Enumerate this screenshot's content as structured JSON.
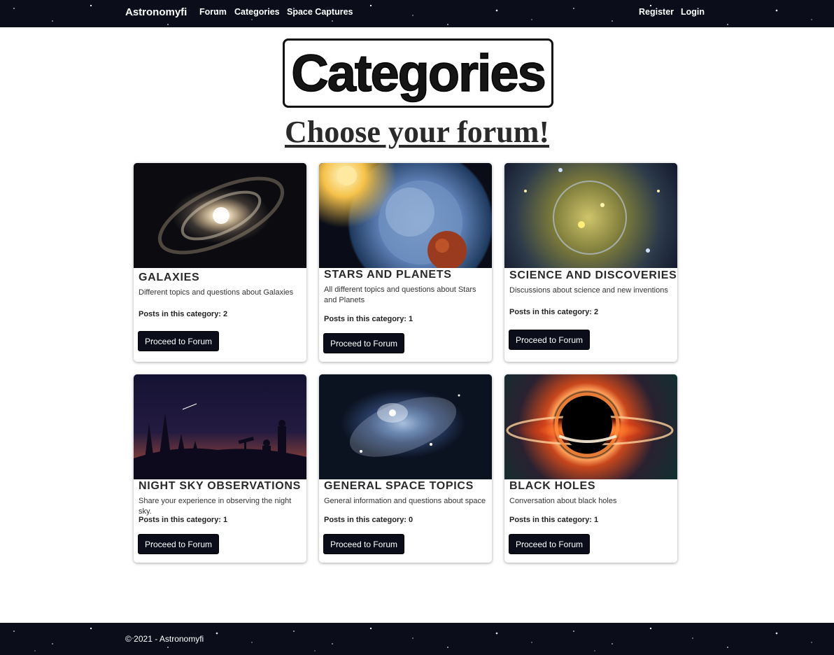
{
  "nav": {
    "brand": "Astronomyfi",
    "links": [
      "Forum",
      "Categories",
      "Space Captures"
    ],
    "register": "Register",
    "login": "Login"
  },
  "header": {
    "logo_text": "Categories",
    "subtitle": "Choose your forum!"
  },
  "cards": [
    {
      "title": "GALAXIES",
      "description": "Different topics and questions about Galaxies",
      "posts_label": "Posts in this category: 2",
      "button": "Proceed to Forum",
      "image_icon": "galaxy-image"
    },
    {
      "title": "STARS AND PLANETS",
      "description": "All different topics and questions about Stars and Planets",
      "posts_label": "Posts in this category: 1",
      "button": "Proceed to Forum",
      "image_icon": "planets-image"
    },
    {
      "title": "SCIENCE AND DISCOVERIES",
      "description": "Discussions about science and new inventions",
      "posts_label": "Posts in this category: 2",
      "button": "Proceed to Forum",
      "image_icon": "science-image"
    },
    {
      "title": "NIGHT SKY OBSERVATIONS",
      "description": "Share your experience in observing the night sky.",
      "posts_label": "Posts in this category: 1",
      "button": "Proceed to Forum",
      "image_icon": "night-sky-image"
    },
    {
      "title": "GENERAL SPACE TOPICS",
      "description": "General information and questions about space",
      "posts_label": "Posts in this category: 0",
      "button": "Proceed to Forum",
      "image_icon": "nebula-image"
    },
    {
      "title": "BLACK HOLES",
      "description": "Conversation about black holes",
      "posts_label": "Posts in this category: 1",
      "button": "Proceed to Forum",
      "image_icon": "black-hole-image"
    }
  ],
  "footer": {
    "text": "© 2021 - Astronomyfi"
  },
  "colors": {
    "navbar_bg": "#0b0e1a",
    "button_bg": "#0b0e1a",
    "title_text": "#2a2a2a"
  }
}
